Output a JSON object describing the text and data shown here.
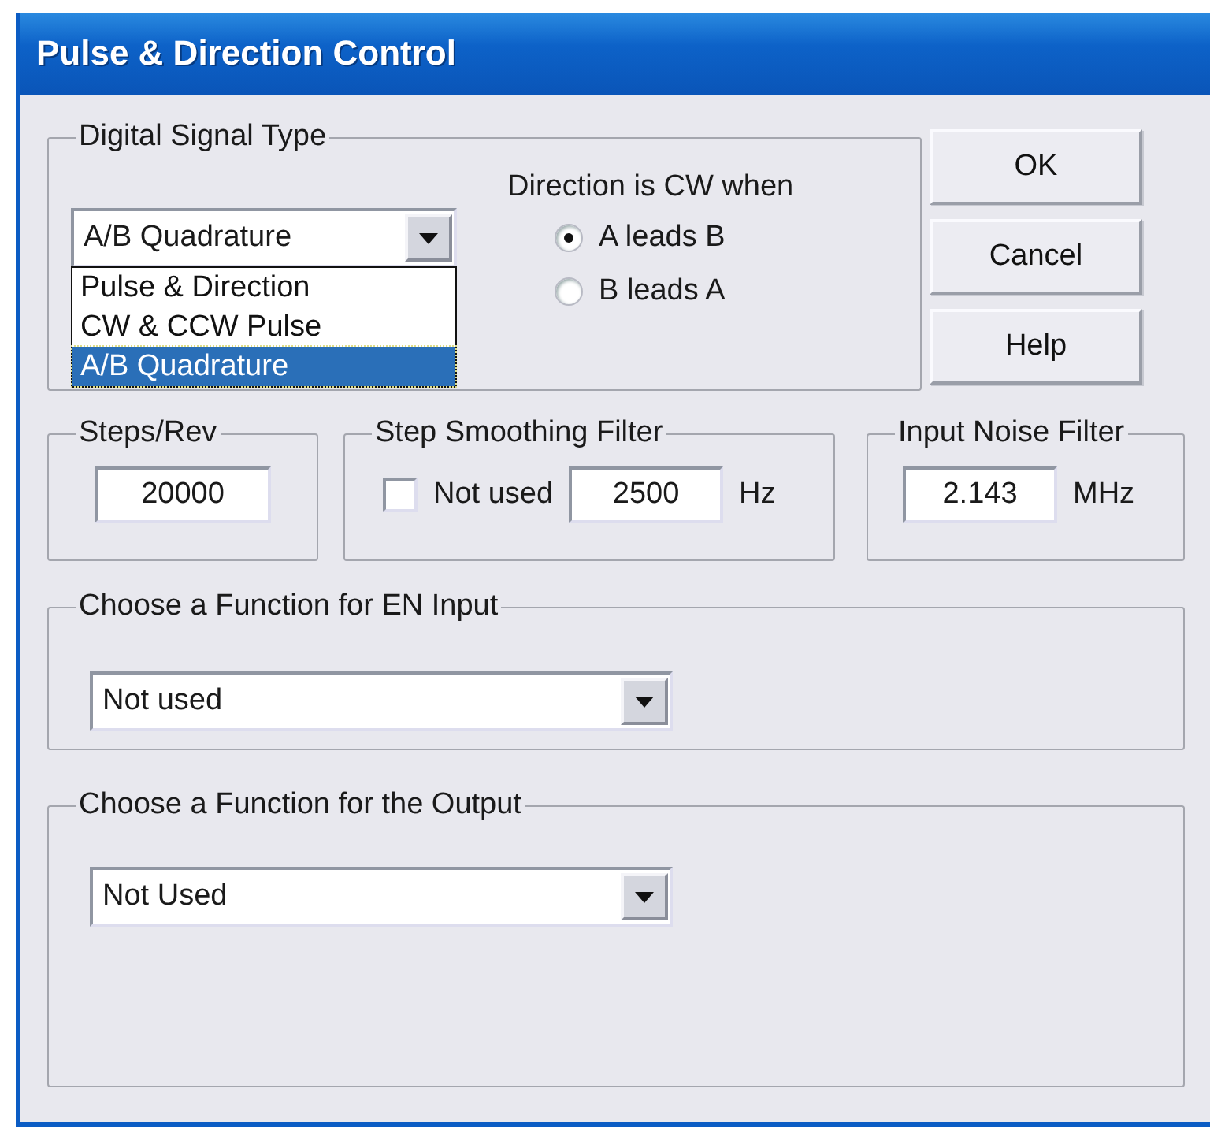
{
  "window": {
    "title": "Pulse & Direction Control"
  },
  "signal_type": {
    "label": "Digital Signal Type",
    "value": "A/B Quadrature",
    "expanded": true,
    "options": [
      {
        "label": "Pulse & Direction",
        "selected": false
      },
      {
        "label": "CW & CCW Pulse",
        "selected": false
      },
      {
        "label": "A/B Quadrature",
        "selected": true
      }
    ]
  },
  "direction": {
    "label": "Direction is CW when",
    "options": [
      {
        "label": "A leads B",
        "selected": true
      },
      {
        "label": "B leads A",
        "selected": false
      }
    ]
  },
  "buttons": [
    "OK",
    "Cancel",
    "Help"
  ],
  "steps_per_rev": {
    "label": "Steps/Rev",
    "value": "20000"
  },
  "step_smoothing": {
    "label": "Step Smoothing Filter",
    "checkbox": {
      "label": "Not used",
      "checked": false
    },
    "value": "2500",
    "unit": "Hz"
  },
  "input_noise": {
    "label": "Input Noise Filter",
    "value": "2.143",
    "unit": "MHz"
  },
  "en_input": {
    "label": "Choose a Function for EN Input",
    "value": "Not used"
  },
  "output": {
    "label": "Choose a Function for the Output",
    "value": "Not Used"
  }
}
